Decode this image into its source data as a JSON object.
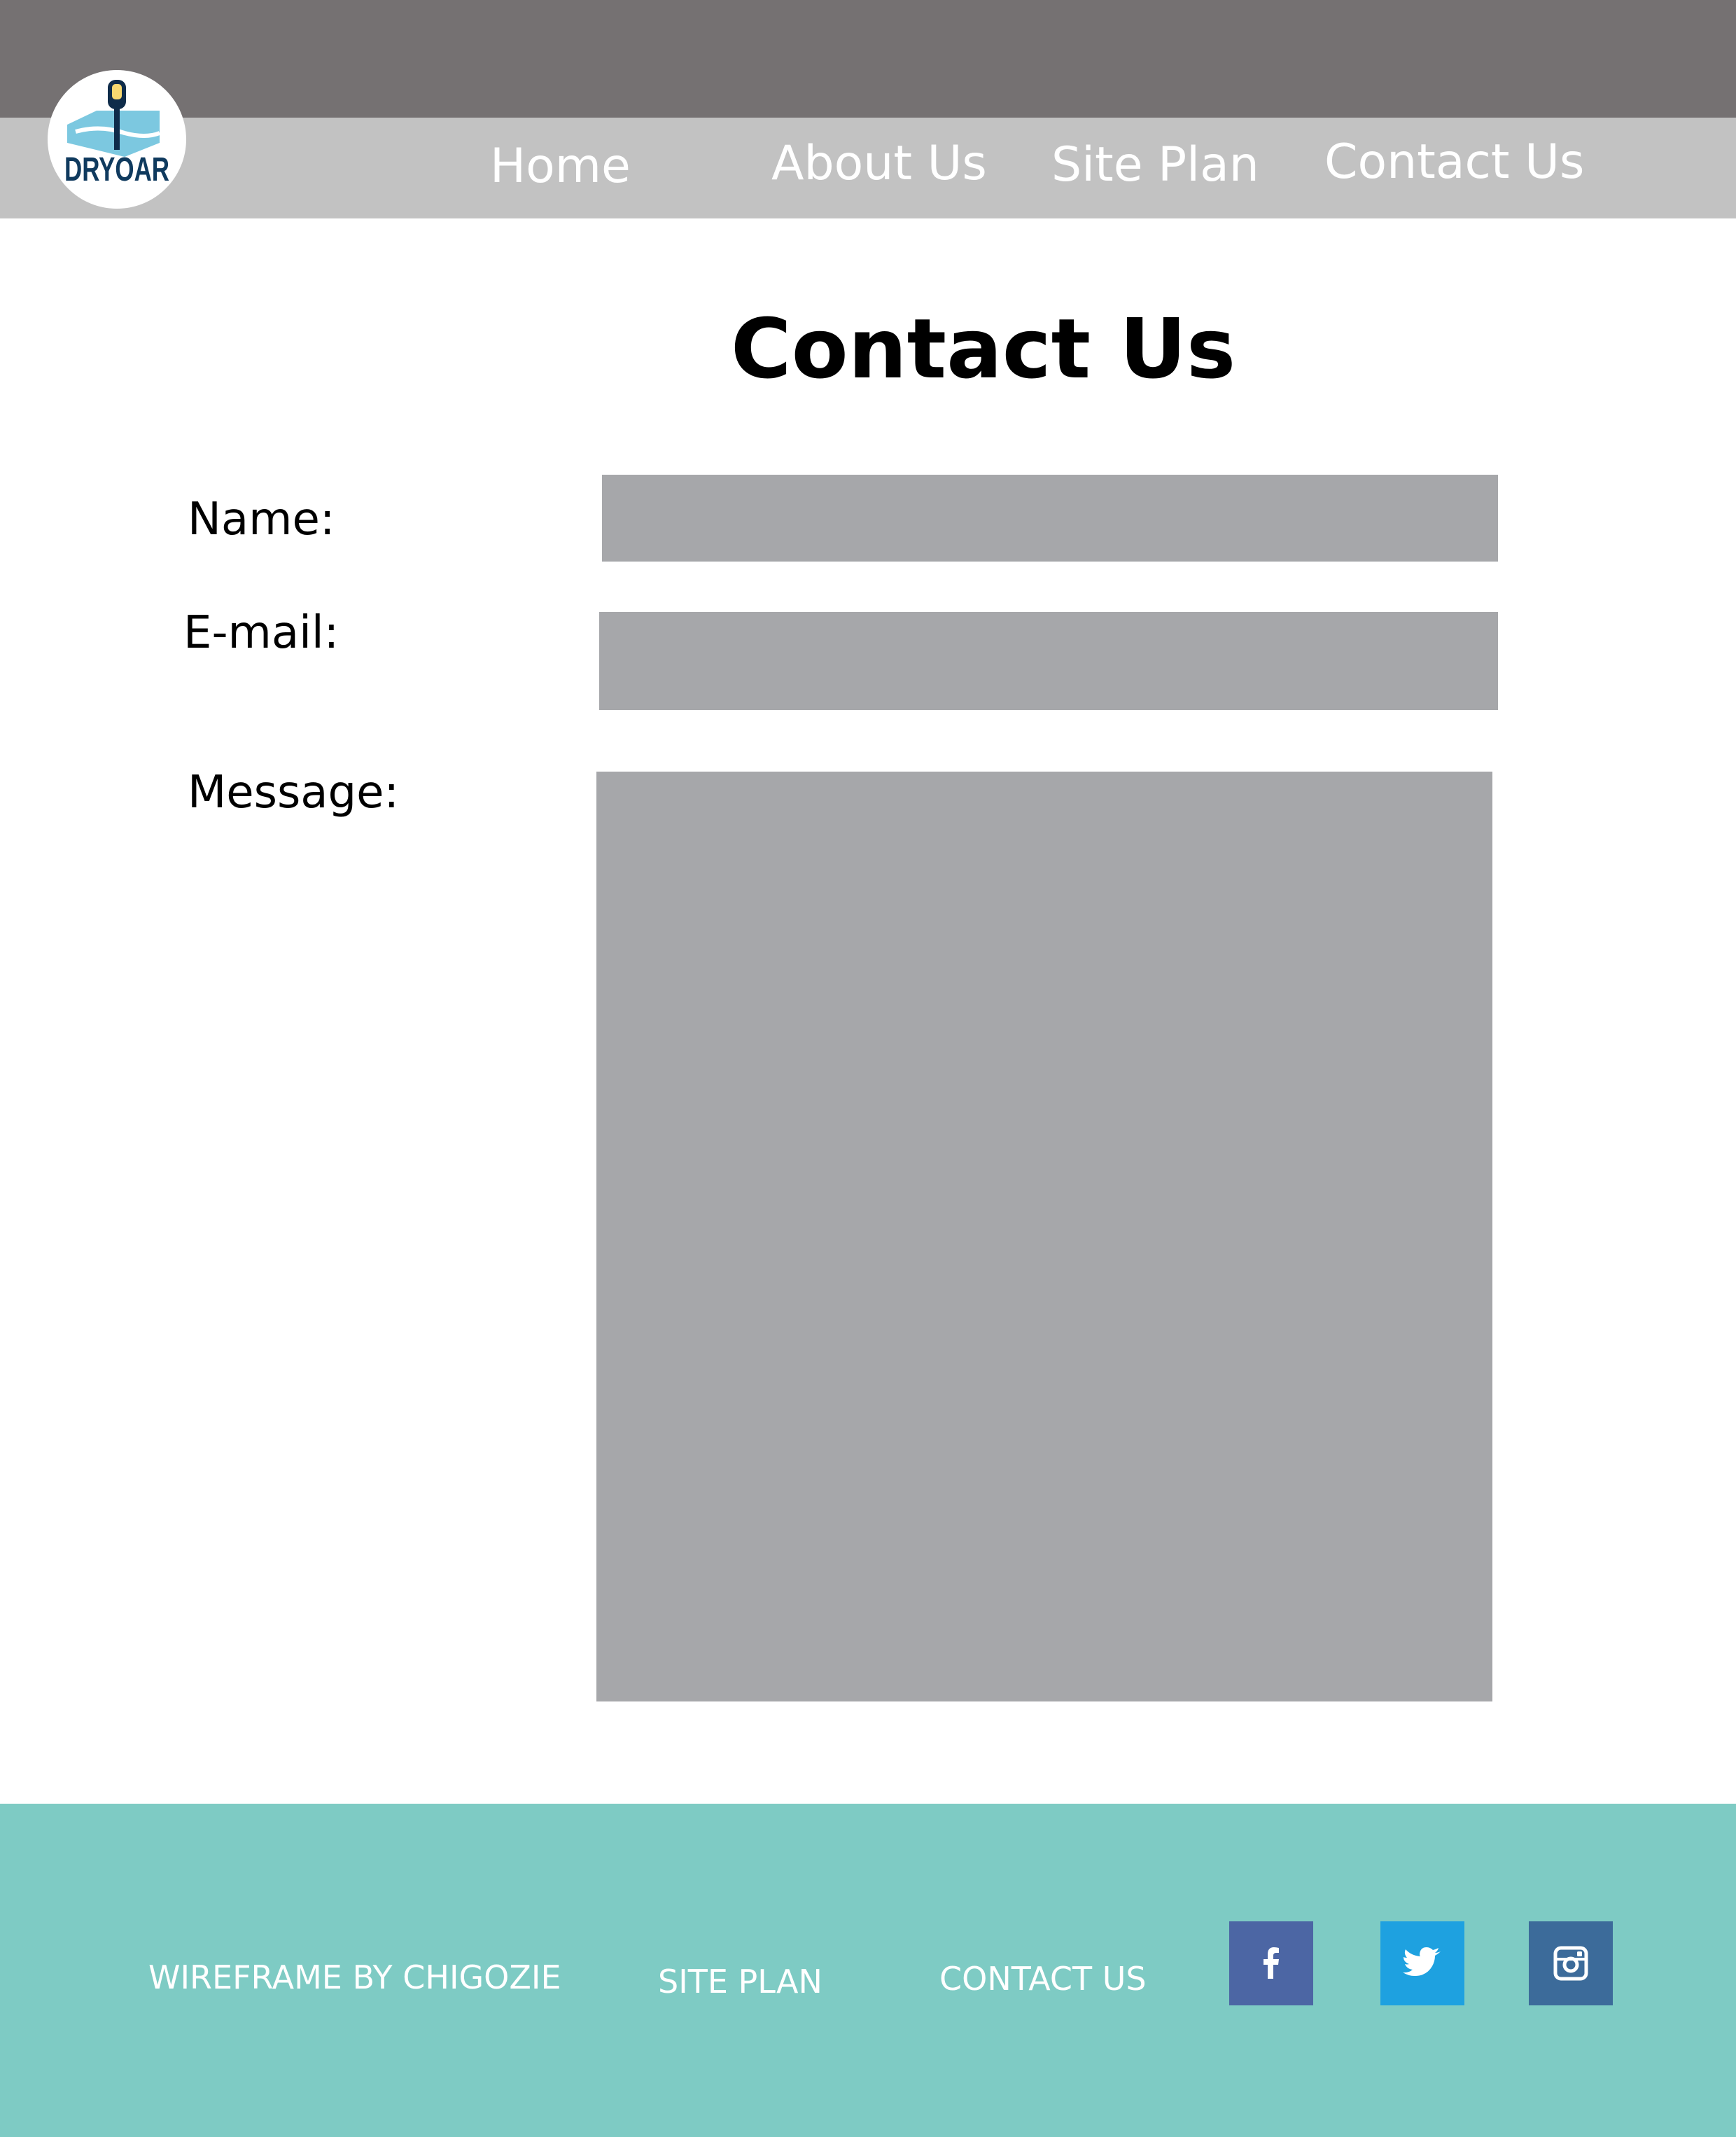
{
  "brand": {
    "logo_text": "DRYOAR"
  },
  "nav": {
    "items": [
      {
        "label": "Home"
      },
      {
        "label": "About Us"
      },
      {
        "label": "Site Plan"
      },
      {
        "label": "Contact Us"
      }
    ]
  },
  "main": {
    "title": "Contact Us",
    "form": {
      "name_label": "Name:",
      "name_value": "",
      "email_label": "E-mail:",
      "email_value": "",
      "message_label": "Message:",
      "message_value": ""
    }
  },
  "footer": {
    "credit": "WIREFRAME BY CHIGOZIE",
    "site_plan": "SITE PLAN",
    "contact_us": "CONTACT US",
    "social": [
      {
        "icon": "facebook-icon",
        "color": "#4c66a4"
      },
      {
        "icon": "twitter-icon",
        "color": "#1ea1e0"
      },
      {
        "icon": "instagram-icon",
        "color": "#3c6b9a"
      }
    ]
  },
  "colors": {
    "topbar": "#757172",
    "navbar": "#c2c2c2",
    "field": "#a6a7aa",
    "footer": "#7ecbc4"
  }
}
